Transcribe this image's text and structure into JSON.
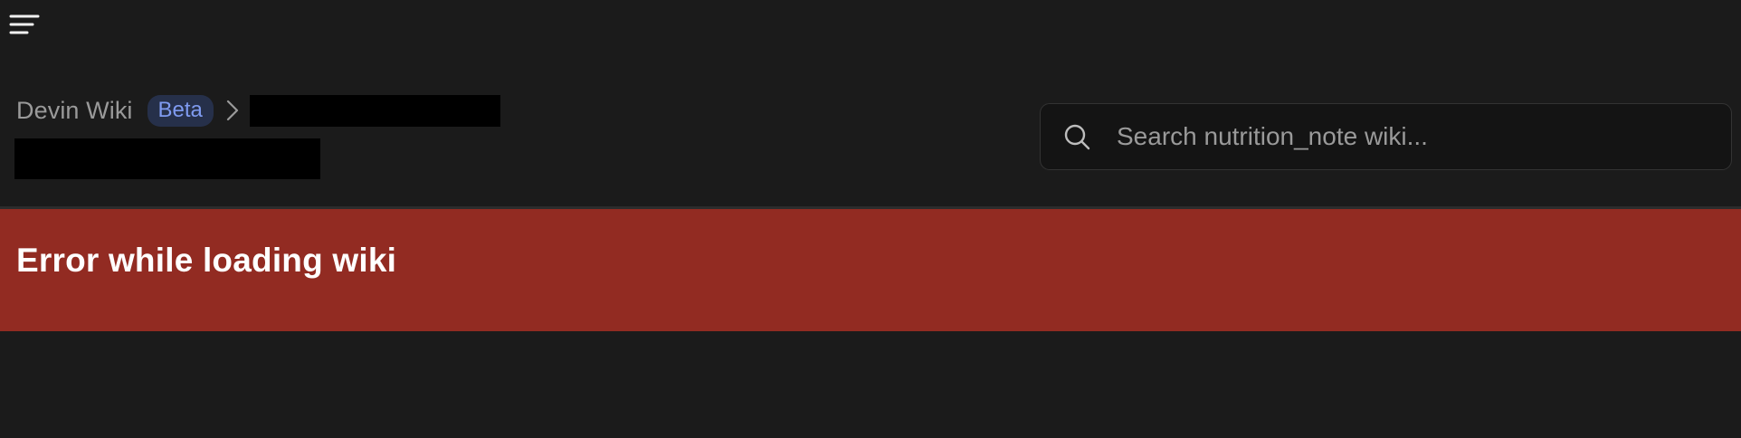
{
  "header": {
    "menu_icon": "hamburger-menu-icon",
    "breadcrumb": {
      "root_label": "Devin Wiki",
      "badge_label": "Beta",
      "separator_icon": "chevron-right-icon"
    }
  },
  "search": {
    "icon": "search-icon",
    "placeholder": "Search nutrition_note wiki...",
    "value": ""
  },
  "error": {
    "message": "Error while loading wiki",
    "color": "#922b22"
  },
  "colors": {
    "background": "#1b1b1b",
    "badge_bg": "#26304a",
    "badge_text": "#7f9bf0"
  }
}
